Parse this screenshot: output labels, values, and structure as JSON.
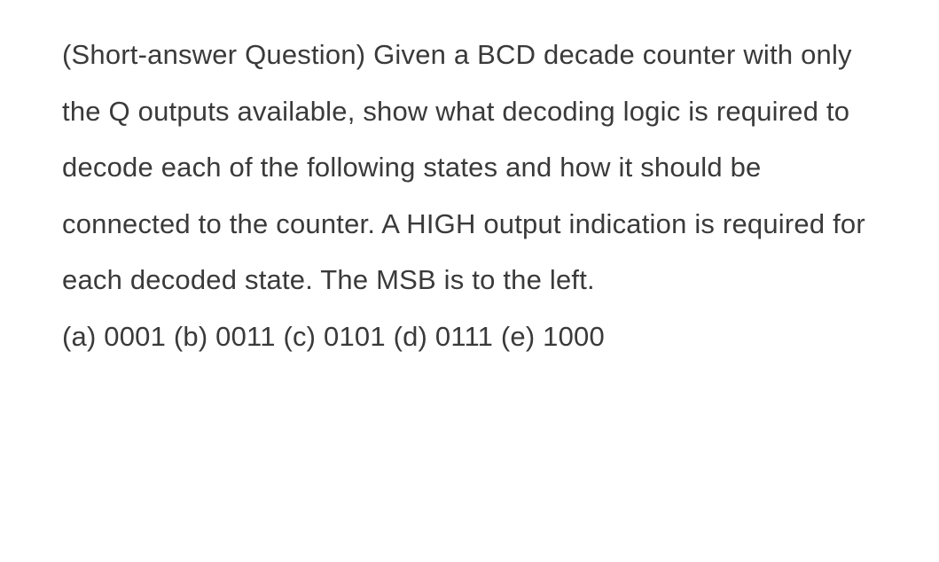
{
  "question": {
    "body": "(Short-answer Question) Given a BCD decade counter with only the Q outputs available, show what decoding logic is required to decode each of the following states and how it should be connected to the counter. A HIGH output indication is required for each decoded state. The MSB is to the left.",
    "options": "(a) 0001 (b) 0011 (c) 0101 (d) 0111 (e) 1000"
  }
}
